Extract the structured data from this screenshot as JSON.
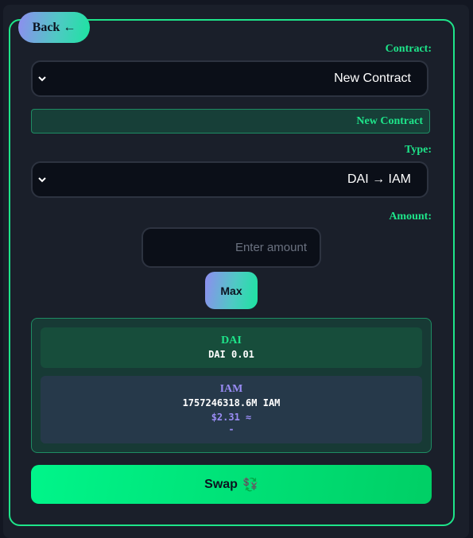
{
  "back_button": {
    "label": "Back",
    "arrow": "←"
  },
  "contract": {
    "label": ":Contract",
    "selected": "New Contract",
    "badge": "New Contract"
  },
  "type": {
    "label": ":Type",
    "selected": "DAI → IAM"
  },
  "amount": {
    "label": ":Amount",
    "placeholder": "Enter amount",
    "value": ""
  },
  "max_button": {
    "label": "Max"
  },
  "summary": {
    "from": {
      "token": "DAI",
      "amount": "DAI 0.01"
    },
    "to": {
      "token": "IAM",
      "amount": "1757246318.6M IAM",
      "usd": "$2.31 ≈",
      "extra": "-"
    }
  },
  "swap_button": {
    "label": "Swap",
    "icon": "💱"
  },
  "colors": {
    "accent": "#1ee58a",
    "iam_accent": "#9a8cf5",
    "background": "#1a1f2a",
    "input_bg": "#0b0f18"
  }
}
